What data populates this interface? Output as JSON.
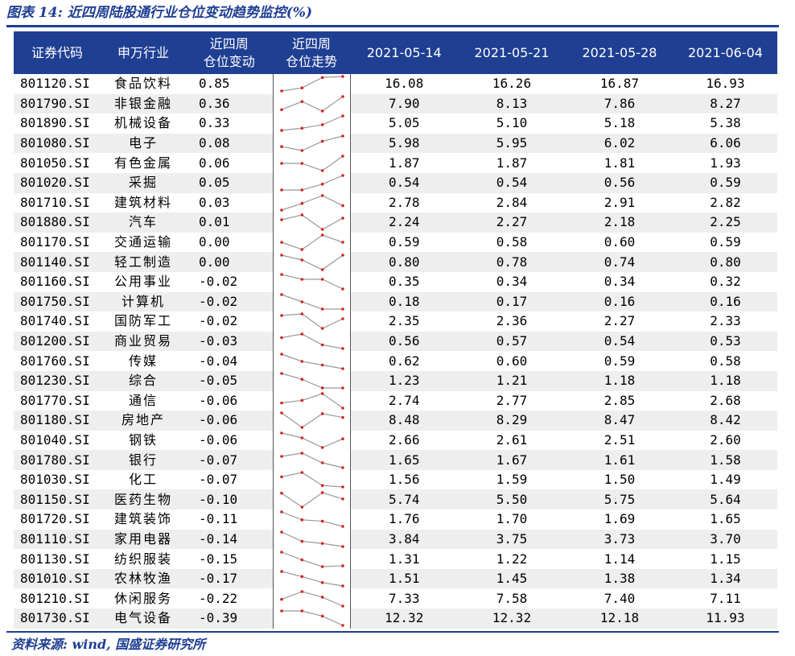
{
  "title": "图表 14:  近四周陆股通行业仓位变动趋势监控(%)",
  "source": "资料来源:  wind,  国盛证券研究所",
  "colors": {
    "header_bg": "#1f3f93",
    "trend_line": "#999999",
    "trend_point": "#d6221e",
    "stripe": "#eeeeee"
  },
  "header": {
    "code": "证券代码",
    "industry": "申万行业",
    "change_line1": "近四周",
    "change_line2": "仓位变动",
    "trend_line1": "近四周",
    "trend_line2": "仓位走势",
    "dates": [
      "2021-05-14",
      "2021-05-21",
      "2021-05-28",
      "2021-06-04"
    ]
  },
  "chart_data": {
    "type": "table",
    "columns": [
      "证券代码",
      "申万行业",
      "近四周仓位变动",
      "近四周仓位走势",
      "2021-05-14",
      "2021-05-21",
      "2021-05-28",
      "2021-06-04"
    ],
    "rows": [
      {
        "code": "801120.SI",
        "industry": "食品饮料",
        "change": "0.85",
        "values": [
          "16.08",
          "16.26",
          "16.87",
          "16.93"
        ]
      },
      {
        "code": "801790.SI",
        "industry": "非银金融",
        "change": "0.36",
        "values": [
          "7.90",
          "8.13",
          "7.86",
          "8.27"
        ]
      },
      {
        "code": "801890.SI",
        "industry": "机械设备",
        "change": "0.33",
        "values": [
          "5.05",
          "5.10",
          "5.18",
          "5.38"
        ]
      },
      {
        "code": "801080.SI",
        "industry": "电子",
        "change": "0.08",
        "values": [
          "5.98",
          "5.95",
          "6.02",
          "6.06"
        ]
      },
      {
        "code": "801050.SI",
        "industry": "有色金属",
        "change": "0.06",
        "values": [
          "1.87",
          "1.87",
          "1.81",
          "1.93"
        ]
      },
      {
        "code": "801020.SI",
        "industry": "采掘",
        "change": "0.05",
        "values": [
          "0.54",
          "0.54",
          "0.56",
          "0.59"
        ]
      },
      {
        "code": "801710.SI",
        "industry": "建筑材料",
        "change": "0.03",
        "values": [
          "2.78",
          "2.84",
          "2.91",
          "2.82"
        ]
      },
      {
        "code": "801880.SI",
        "industry": "汽车",
        "change": "0.01",
        "values": [
          "2.24",
          "2.27",
          "2.18",
          "2.25"
        ]
      },
      {
        "code": "801170.SI",
        "industry": "交通运输",
        "change": "0.00",
        "values": [
          "0.59",
          "0.58",
          "0.60",
          "0.59"
        ]
      },
      {
        "code": "801140.SI",
        "industry": "轻工制造",
        "change": "0.00",
        "values": [
          "0.80",
          "0.78",
          "0.74",
          "0.80"
        ]
      },
      {
        "code": "801160.SI",
        "industry": "公用事业",
        "change": "-0.02",
        "values": [
          "0.35",
          "0.34",
          "0.34",
          "0.32"
        ]
      },
      {
        "code": "801750.SI",
        "industry": "计算机",
        "change": "-0.02",
        "values": [
          "0.18",
          "0.17",
          "0.16",
          "0.16"
        ]
      },
      {
        "code": "801740.SI",
        "industry": "国防军工",
        "change": "-0.02",
        "values": [
          "2.35",
          "2.36",
          "2.27",
          "2.33"
        ]
      },
      {
        "code": "801200.SI",
        "industry": "商业贸易",
        "change": "-0.03",
        "values": [
          "0.56",
          "0.57",
          "0.54",
          "0.53"
        ]
      },
      {
        "code": "801760.SI",
        "industry": "传媒",
        "change": "-0.04",
        "values": [
          "0.62",
          "0.60",
          "0.59",
          "0.58"
        ]
      },
      {
        "code": "801230.SI",
        "industry": "综合",
        "change": "-0.05",
        "values": [
          "1.23",
          "1.21",
          "1.18",
          "1.18"
        ]
      },
      {
        "code": "801770.SI",
        "industry": "通信",
        "change": "-0.06",
        "values": [
          "2.74",
          "2.77",
          "2.85",
          "2.68"
        ]
      },
      {
        "code": "801180.SI",
        "industry": "房地产",
        "change": "-0.06",
        "values": [
          "8.48",
          "8.29",
          "8.47",
          "8.42"
        ]
      },
      {
        "code": "801040.SI",
        "industry": "钢铁",
        "change": "-0.06",
        "values": [
          "2.66",
          "2.61",
          "2.51",
          "2.60"
        ]
      },
      {
        "code": "801780.SI",
        "industry": "银行",
        "change": "-0.07",
        "values": [
          "1.65",
          "1.67",
          "1.61",
          "1.58"
        ]
      },
      {
        "code": "801030.SI",
        "industry": "化工",
        "change": "-0.07",
        "values": [
          "1.56",
          "1.59",
          "1.50",
          "1.49"
        ]
      },
      {
        "code": "801150.SI",
        "industry": "医药生物",
        "change": "-0.10",
        "values": [
          "5.74",
          "5.50",
          "5.75",
          "5.64"
        ]
      },
      {
        "code": "801720.SI",
        "industry": "建筑装饰",
        "change": "-0.11",
        "values": [
          "1.76",
          "1.70",
          "1.69",
          "1.65"
        ]
      },
      {
        "code": "801110.SI",
        "industry": "家用电器",
        "change": "-0.14",
        "values": [
          "3.84",
          "3.75",
          "3.73",
          "3.70"
        ]
      },
      {
        "code": "801130.SI",
        "industry": "纺织服装",
        "change": "-0.15",
        "values": [
          "1.31",
          "1.22",
          "1.14",
          "1.15"
        ]
      },
      {
        "code": "801010.SI",
        "industry": "农林牧渔",
        "change": "-0.17",
        "values": [
          "1.51",
          "1.45",
          "1.38",
          "1.34"
        ]
      },
      {
        "code": "801210.SI",
        "industry": "休闲服务",
        "change": "-0.22",
        "values": [
          "7.33",
          "7.58",
          "7.40",
          "7.11"
        ]
      },
      {
        "code": "801730.SI",
        "industry": "电气设备",
        "change": "-0.39",
        "values": [
          "12.32",
          "12.32",
          "12.18",
          "11.93"
        ]
      }
    ]
  }
}
